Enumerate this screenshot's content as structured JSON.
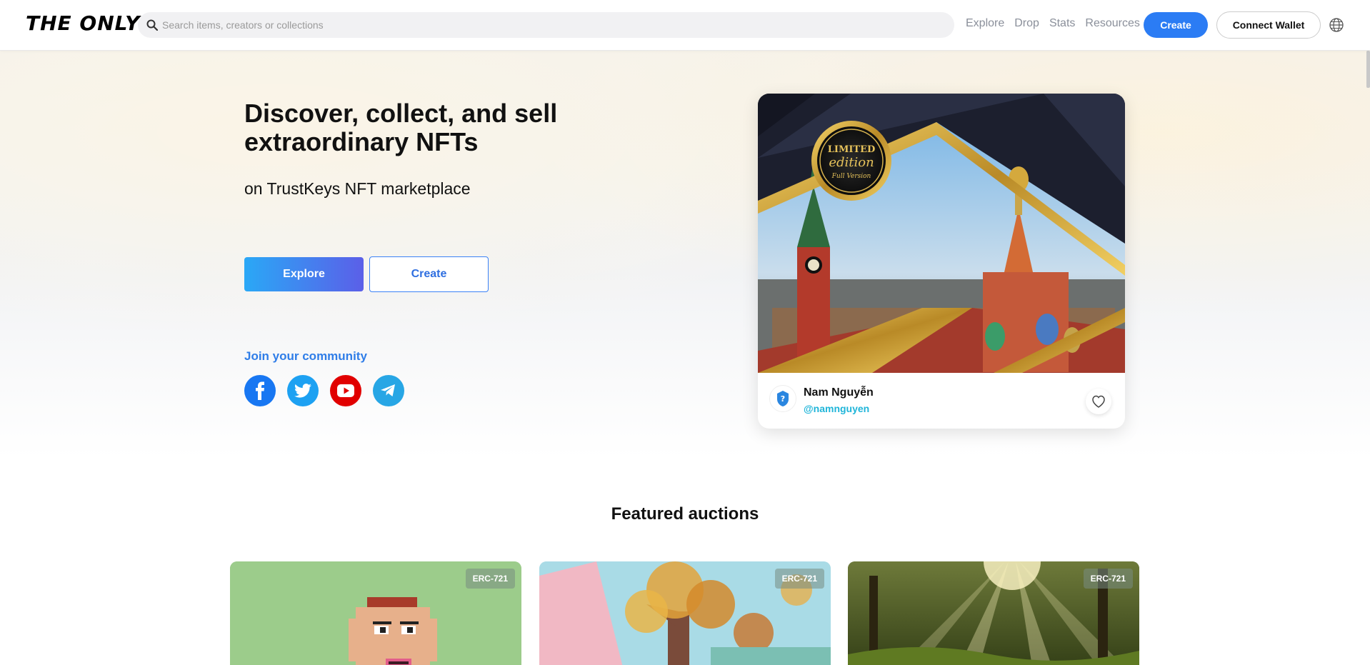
{
  "header": {
    "logo_text": "THE ONLY",
    "search_placeholder": "Search items, creators or collections",
    "nav": [
      "Explore",
      "Drop",
      "Stats",
      "Resources"
    ],
    "create_label": "Create",
    "wallet_label": "Connect Wallet",
    "accent_color": "#2b7cf4"
  },
  "hero": {
    "title": "Discover, collect, and sell extraordinary NFTs",
    "subtitle": "on TrustKeys NFT marketplace",
    "explore_label": "Explore",
    "create_label": "Create",
    "community_label": "Join your community",
    "socials": [
      "facebook-icon",
      "twitter-icon",
      "youtube-icon",
      "telegram-icon"
    ]
  },
  "featured_card": {
    "seal_line1": "LIMITED",
    "seal_line2": "edition",
    "seal_line3": "Full Version",
    "creator_name": "Nam Nguyễn",
    "creator_handle": "@namnguyen"
  },
  "auctions": {
    "title": "Featured auctions",
    "items": [
      {
        "badge": "ERC-721"
      },
      {
        "badge": "ERC-721"
      },
      {
        "badge": "ERC-721"
      }
    ]
  }
}
